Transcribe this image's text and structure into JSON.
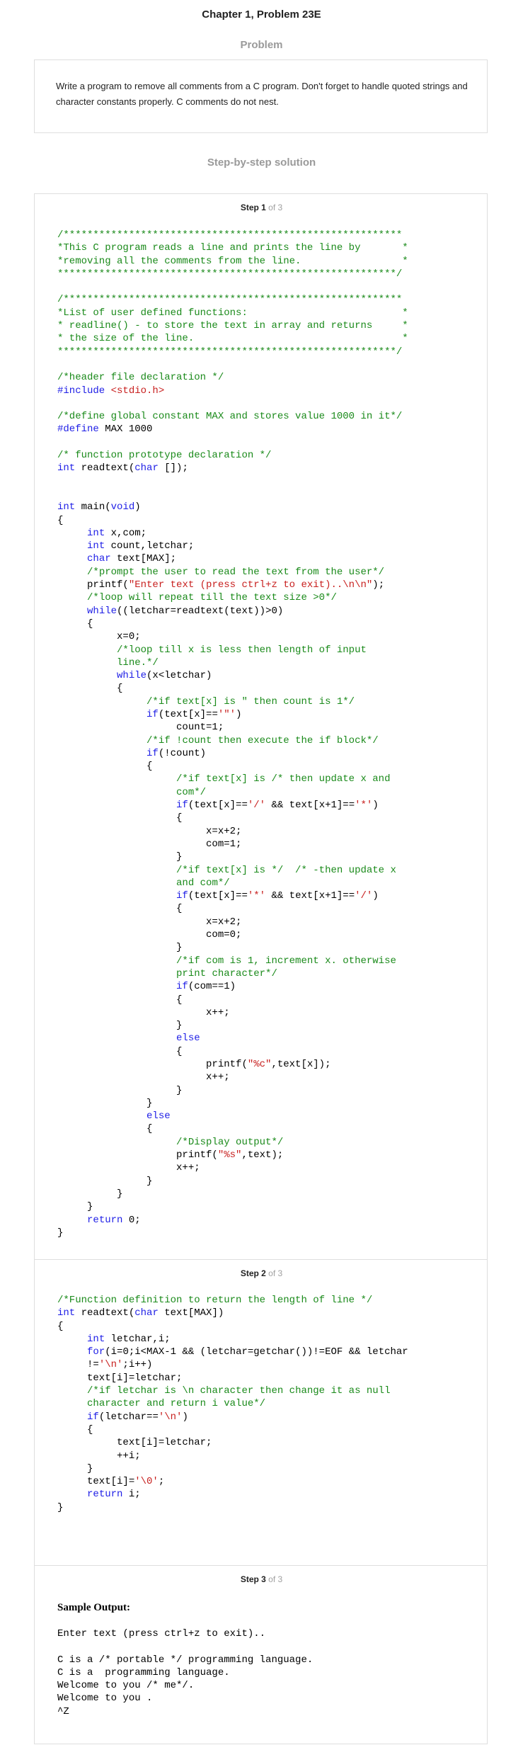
{
  "page": {
    "title": "Chapter 1, Problem 23E",
    "problem_label": "Problem",
    "problem_text": "Write a program to remove all comments from a C program. Don't forget to handle quoted strings and character constants properly. C comments do not nest.",
    "solution_label": "Step-by-step solution"
  },
  "steps": [
    {
      "label": "Step 1",
      "of": " of 3"
    },
    {
      "label": "Step 2",
      "of": " of 3"
    },
    {
      "label": "Step 3",
      "of": " of 3"
    }
  ],
  "step1_code": [
    [
      [
        "c",
        "/*********************************************************"
      ]
    ],
    [
      [
        "c",
        "*This C program reads a line and prints the line by       *"
      ]
    ],
    [
      [
        "c",
        "*removing all the comments from the line.                 *"
      ]
    ],
    [
      [
        "c",
        "*********************************************************/"
      ]
    ],
    [],
    [
      [
        "c",
        "/*********************************************************"
      ]
    ],
    [
      [
        "c",
        "*List of user defined functions:                          *"
      ]
    ],
    [
      [
        "c",
        "* readline() - to store the text in array and returns     *"
      ]
    ],
    [
      [
        "c",
        "* the size of the line.                                   *"
      ]
    ],
    [
      [
        "c",
        "*********************************************************/"
      ]
    ],
    [],
    [
      [
        "c",
        "/*header file declaration */"
      ]
    ],
    [
      [
        "k",
        "#include "
      ],
      [
        "s",
        "<stdio.h>"
      ]
    ],
    [],
    [
      [
        "c",
        "/*define global constant MAX and stores value 1000 in it*/"
      ]
    ],
    [
      [
        "k",
        "#define"
      ],
      [
        "t",
        " MAX 1000"
      ]
    ],
    [],
    [
      [
        "c",
        "/* function prototype declaration */"
      ]
    ],
    [
      [
        "k",
        "int"
      ],
      [
        "t",
        " readtext("
      ],
      [
        "k",
        "char"
      ],
      [
        "t",
        " []);"
      ]
    ],
    [],
    [],
    [
      [
        "k",
        "int"
      ],
      [
        "t",
        " main("
      ],
      [
        "k",
        "void"
      ],
      [
        "t",
        ")"
      ]
    ],
    [
      [
        "t",
        "{"
      ]
    ],
    [
      [
        "t",
        "     "
      ],
      [
        "k",
        "int"
      ],
      [
        "t",
        " x,com;"
      ]
    ],
    [
      [
        "t",
        "     "
      ],
      [
        "k",
        "int"
      ],
      [
        "t",
        " count,letchar;"
      ]
    ],
    [
      [
        "t",
        "     "
      ],
      [
        "k",
        "char"
      ],
      [
        "t",
        " text[MAX];"
      ]
    ],
    [
      [
        "t",
        "     "
      ],
      [
        "c",
        "/*prompt the user to read the text from the user*/"
      ]
    ],
    [
      [
        "t",
        "     printf("
      ],
      [
        "s",
        "\"Enter text (press ctrl+z to exit)..\\n\\n\""
      ],
      [
        "t",
        ");"
      ]
    ],
    [
      [
        "t",
        "     "
      ],
      [
        "c",
        "/*loop will repeat till the text size >0*/"
      ]
    ],
    [
      [
        "t",
        "     "
      ],
      [
        "k",
        "while"
      ],
      [
        "t",
        "((letchar=readtext(text))>0)"
      ]
    ],
    [
      [
        "t",
        "     {"
      ]
    ],
    [
      [
        "t",
        "          x=0;"
      ]
    ],
    [
      [
        "t",
        "          "
      ],
      [
        "c",
        "/*loop till x is less then length of input"
      ]
    ],
    [
      [
        "t",
        "          "
      ],
      [
        "c",
        "line.*/"
      ]
    ],
    [
      [
        "t",
        "          "
      ],
      [
        "k",
        "while"
      ],
      [
        "t",
        "(x<letchar)"
      ]
    ],
    [
      [
        "t",
        "          {"
      ]
    ],
    [
      [
        "t",
        "               "
      ],
      [
        "c",
        "/*if text[x] is \" then count is 1*/"
      ]
    ],
    [
      [
        "t",
        "               "
      ],
      [
        "k",
        "if"
      ],
      [
        "t",
        "(text[x]=="
      ],
      [
        "s",
        "'\"'"
      ],
      [
        "t",
        ")"
      ]
    ],
    [
      [
        "t",
        "                    count=1;"
      ]
    ],
    [
      [
        "t",
        "               "
      ],
      [
        "c",
        "/*if !count then execute the if block*/"
      ]
    ],
    [
      [
        "t",
        "               "
      ],
      [
        "k",
        "if"
      ],
      [
        "t",
        "(!count)"
      ]
    ],
    [
      [
        "t",
        "               {"
      ]
    ],
    [
      [
        "t",
        "                    "
      ],
      [
        "c",
        "/*if text[x] is /* then update x and"
      ]
    ],
    [
      [
        "t",
        "                    "
      ],
      [
        "c",
        "com*/"
      ]
    ],
    [
      [
        "t",
        "                    "
      ],
      [
        "k",
        "if"
      ],
      [
        "t",
        "(text[x]=="
      ],
      [
        "s",
        "'/'"
      ],
      [
        "t",
        " && text[x+1]=="
      ],
      [
        "s",
        "'*'"
      ],
      [
        "t",
        ")"
      ]
    ],
    [
      [
        "t",
        "                    {"
      ]
    ],
    [
      [
        "t",
        "                         x=x+2;"
      ]
    ],
    [
      [
        "t",
        "                         com=1;"
      ]
    ],
    [
      [
        "t",
        "                    }"
      ]
    ],
    [
      [
        "t",
        "                    "
      ],
      [
        "c",
        "/*if text[x] is */  /* -then update x"
      ]
    ],
    [
      [
        "t",
        "                    "
      ],
      [
        "c",
        "and com*/"
      ]
    ],
    [
      [
        "t",
        "                    "
      ],
      [
        "k",
        "if"
      ],
      [
        "t",
        "(text[x]=="
      ],
      [
        "s",
        "'*'"
      ],
      [
        "t",
        " && text[x+1]=="
      ],
      [
        "s",
        "'/'"
      ],
      [
        "t",
        ")"
      ]
    ],
    [
      [
        "t",
        "                    {"
      ]
    ],
    [
      [
        "t",
        "                         x=x+2;"
      ]
    ],
    [
      [
        "t",
        "                         com=0;"
      ]
    ],
    [
      [
        "t",
        "                    }"
      ]
    ],
    [
      [
        "t",
        "                    "
      ],
      [
        "c",
        "/*if com is 1, increment x. otherwise"
      ]
    ],
    [
      [
        "t",
        "                    "
      ],
      [
        "c",
        "print character*/"
      ]
    ],
    [
      [
        "t",
        "                    "
      ],
      [
        "k",
        "if"
      ],
      [
        "t",
        "(com==1)"
      ]
    ],
    [
      [
        "t",
        "                    {"
      ]
    ],
    [
      [
        "t",
        "                         x++;"
      ]
    ],
    [
      [
        "t",
        "                    }"
      ]
    ],
    [
      [
        "t",
        "                    "
      ],
      [
        "k",
        "else"
      ]
    ],
    [
      [
        "t",
        "                    {"
      ]
    ],
    [
      [
        "t",
        "                         printf("
      ],
      [
        "s",
        "\"%c\""
      ],
      [
        "t",
        ",text[x]);"
      ]
    ],
    [
      [
        "t",
        "                         x++;"
      ]
    ],
    [
      [
        "t",
        "                    }"
      ]
    ],
    [
      [
        "t",
        "               }"
      ]
    ],
    [
      [
        "t",
        "               "
      ],
      [
        "k",
        "else"
      ]
    ],
    [
      [
        "t",
        "               {"
      ]
    ],
    [
      [
        "t",
        "                    "
      ],
      [
        "c",
        "/*Display output*/"
      ]
    ],
    [
      [
        "t",
        "                    printf("
      ],
      [
        "s",
        "\"%s\""
      ],
      [
        "t",
        ",text);"
      ]
    ],
    [
      [
        "t",
        "                    x++;"
      ]
    ],
    [
      [
        "t",
        "               }"
      ]
    ],
    [
      [
        "t",
        "          }"
      ]
    ],
    [
      [
        "t",
        "     }"
      ]
    ],
    [
      [
        "t",
        "     "
      ],
      [
        "k",
        "return"
      ],
      [
        "t",
        " 0;"
      ]
    ],
    [
      [
        "t",
        "}"
      ]
    ]
  ],
  "step2_code": [
    [
      [
        "c",
        "/*Function definition to return the length of line */"
      ]
    ],
    [
      [
        "k",
        "int"
      ],
      [
        "t",
        " readtext("
      ],
      [
        "k",
        "char"
      ],
      [
        "t",
        " text[MAX])"
      ]
    ],
    [
      [
        "t",
        "{"
      ]
    ],
    [
      [
        "t",
        "     "
      ],
      [
        "k",
        "int"
      ],
      [
        "t",
        " letchar,i;"
      ]
    ],
    [
      [
        "t",
        "     "
      ],
      [
        "k",
        "for"
      ],
      [
        "t",
        "(i=0;i<MAX-1 && (letchar=getchar())!=EOF && letchar"
      ]
    ],
    [
      [
        "t",
        "     !="
      ],
      [
        "s",
        "'\\n'"
      ],
      [
        "t",
        ";i++)"
      ]
    ],
    [
      [
        "t",
        "     text[i]=letchar;"
      ]
    ],
    [
      [
        "t",
        "     "
      ],
      [
        "c",
        "/*if letchar is \\n character then change it as null"
      ]
    ],
    [
      [
        "t",
        "     "
      ],
      [
        "c",
        "character and return i value*/"
      ]
    ],
    [
      [
        "t",
        "     "
      ],
      [
        "k",
        "if"
      ],
      [
        "t",
        "(letchar=="
      ],
      [
        "s",
        "'\\n'"
      ],
      [
        "t",
        ")"
      ]
    ],
    [
      [
        "t",
        "     {"
      ]
    ],
    [
      [
        "t",
        "          text[i]=letchar;"
      ]
    ],
    [
      [
        "t",
        "          ++i;"
      ]
    ],
    [
      [
        "t",
        "     }"
      ]
    ],
    [
      [
        "t",
        "     text[i]="
      ],
      [
        "s",
        "'\\0'"
      ],
      [
        "t",
        ";"
      ]
    ],
    [
      [
        "t",
        "     "
      ],
      [
        "k",
        "return"
      ],
      [
        "t",
        " i;"
      ]
    ],
    [
      [
        "t",
        "}"
      ]
    ]
  ],
  "step3": {
    "sample_heading": "Sample Output:",
    "output_lines": [
      "Enter text (press ctrl+z to exit)..",
      "",
      "C is a /* portable */ programming language.",
      "C is a  programming language.",
      "Welcome to you /* me*/.",
      "Welcome to you .",
      "^Z"
    ]
  }
}
